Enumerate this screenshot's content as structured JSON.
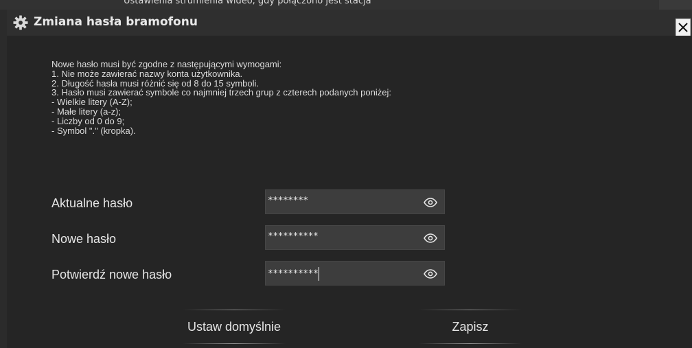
{
  "background": {
    "partial_text": "Ustawienia strumienia wideo, gdy połączono jest stacja"
  },
  "dialog": {
    "title": "Zmiana hasła bramofonu",
    "icon": "gear-icon",
    "close_icon": "close-icon"
  },
  "requirements": [
    "Nowe hasło musi być zgodne z następującymi wymogami:",
    "1. Nie może zawierać nazwy konta użytkownika.",
    "2. Długość hasła musi różnić się od 8 do 15 symboli.",
    "3. Hasło musi zawierać symbole co najmniej trzech grup z czterech podanych poniżej:",
    "- Wielkie litery (A-Z);",
    "- Małe litery (a-z);",
    "- Liczby od 0 do 9;",
    "- Symbol \".\" (kropka)."
  ],
  "fields": {
    "current": {
      "label": "Aktualne hasło",
      "value": "********"
    },
    "new": {
      "label": "Nowe hasło",
      "value": "**********"
    },
    "confirm": {
      "label": "Potwierdź nowe hasło",
      "value": "**********"
    }
  },
  "buttons": {
    "reset_label": "Ustaw domyślnie",
    "save_label": "Zapisz"
  },
  "colors": {
    "dialog_bg": "#252525",
    "titlebar_bg": "#2f2f2f",
    "input_bg": "#3d3d3d",
    "text": "#e6e6e6"
  }
}
